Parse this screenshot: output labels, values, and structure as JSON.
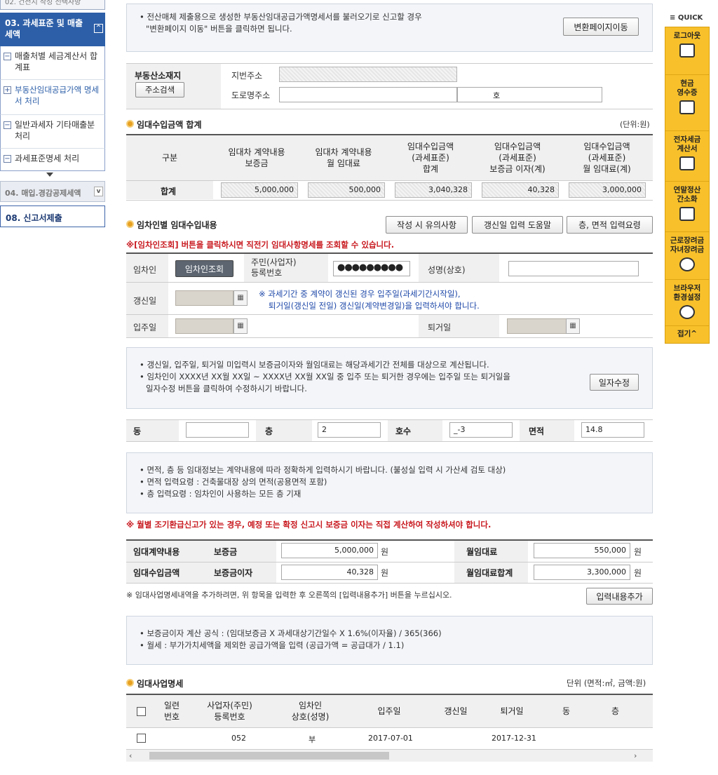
{
  "nav": {
    "top_text": "02. 건전지 작성 선택사항",
    "sec03": "03. 과세표준 및 매출세액",
    "items": [
      "매출처별 세금계산서 합계표",
      "부동산임대공급가액 명세서 처리",
      "일반과세자 기타매출분 처리",
      "과세표준명세 처리"
    ],
    "sec04": "04. 매입.경감공제세액",
    "sec08": "08. 신고서제출"
  },
  "notice1": {
    "text1": "전산매체 제출용으로 생성한 부동산임대공급가액명세서를 불러오기로 신고할 경우",
    "text2": "\"변환페이지 이동\" 버튼을 클릭하면 됩니다.",
    "button": "변환페이지이동"
  },
  "address": {
    "label": "부동산소재지",
    "search_button": "주소검색",
    "jibun_label": "지번주소",
    "road_label": "도로명주소",
    "road_extra": "호"
  },
  "summary": {
    "title": "임대수입금액 합계",
    "unit": "(단위:원)",
    "headers": [
      "구분",
      "임대차 계약내용\n보증금",
      "임대차 계약내용\n월 임대료",
      "임대수입금액\n(과세표준)\n합계",
      "임대수입금액\n(과세표준)\n보증금 이자(계)",
      "임대수입금액\n(과세표준)\n월 임대료(계)"
    ],
    "row_label": "합계",
    "values": [
      "5,000,000",
      "500,000",
      "3,040,328",
      "40,328",
      "3,000,000"
    ]
  },
  "tenant": {
    "title": "임차인별 임대수입내용",
    "buttons": [
      "작성 시 유의사항",
      "갱신일 입력 도움말",
      "층, 면적 입력요령"
    ],
    "red_note": "※[임차인조회] 버튼을 클릭하시면 직전기 임대사항명세를 조회할 수 있습니다.",
    "tenant_label": "임차인",
    "lookup_button": "임차인조회",
    "resid_label": "주민(사업자)\n등록번호",
    "resid_value": "●●●●●●●●●",
    "name_label": "성명(상호)",
    "renew_label": "갱신일",
    "renew_note1": "※ 과세기간 중 계약이 갱신된 경우 입주일(과세기간시작일),",
    "renew_note2": "퇴거일(갱신일 전일) 갱신일(계약변경일)을 입력하셔야 합니다.",
    "movein_label": "입주일",
    "moveout_label": "퇴거일"
  },
  "notice2": {
    "line1": "갱신일, 입주일, 퇴거일 미입력시 보증금이자와 월임대료는 해당과세기간 전체를 대상으로 계산됩니다.",
    "line2": "임차인이 XXXX년 XX월 XX일 ~ XXXX년 XX월 XX일 중 입주 또는 퇴거한 경우에는 입주일 또는 퇴거일을",
    "line3": "일자수정 버튼을 클릭하여 수정하시기 바랍니다.",
    "button": "일자수정"
  },
  "unit_row": {
    "dong_label": "동",
    "floor_label": "층",
    "floor_value": "2",
    "ho_label": "호수",
    "ho_value": "_-3",
    "area_label": "면적",
    "area_value": "14.8"
  },
  "notice3": {
    "line1": "면적, 층 등 임대정보는 계약내용에 따라 정확하게 입력하시기 바랍니다. (불성실 입력 시 가산세 검토 대상)",
    "line2": "면적 입력요령 : 건축물대장 상의 면적(공용면적 포함)",
    "line3": "층 입력요령 : 임차인이 사용하는 모든 층 기재"
  },
  "red_note2": "※ 월별 조기환급신고가 있는 경우, 예정 또는 확정 신고시 보증금 이자는 직접 계산하여 작성하셔야 합니다.",
  "contract": {
    "contract_label": "임대계약내용",
    "deposit_label": "보증금",
    "deposit_value": "5,000,000",
    "won": "원",
    "monthly_label": "월임대료",
    "monthly_value": "550,000",
    "income_label": "임대수입금액",
    "interest_label": "보증금이자",
    "interest_value": "40,328",
    "total_label": "월임대료합계",
    "total_value": "3,300,000"
  },
  "add_note": "※ 임대사업명세내역을 추가하려면, 위 항목을 입력한 후 오른쪽의 [입력내용추가] 버튼을 누르십시오.",
  "add_button": "입력내용추가",
  "notice4": {
    "line1": "보증금이자 계산 공식 : (임대보증금 X 과세대상기간일수 X 1.6%(이자율) / 365(366)",
    "line2": "월세 : 부가가치세액을 제외한 공급가액을 입력 (공급가액 = 공급대가 / 1.1)"
  },
  "biz": {
    "title": "임대사업명세",
    "unit": "단위 (면적:㎡, 금액:원)",
    "headers": [
      "일련\n번호",
      "사업자(주민)\n등록번호",
      "임차인\n상호(성명)",
      "입주일",
      "갱신일",
      "퇴거일",
      "동",
      "층"
    ],
    "row": {
      "resid": "052",
      "name": "부",
      "movein": "2017-07-01",
      "moveout": "2017-12-31"
    }
  },
  "quick": {
    "title": "≡ QUICK",
    "items": [
      "로그아웃",
      "현금\n영수증",
      "전자세금\n계산서",
      "연말정산\n간소화",
      "근로장려금\n자녀장려금",
      "브라우저\n환경설정"
    ],
    "close": "접기^"
  },
  "colors": {
    "nav_blue": "#2d5fa8",
    "accent_orange": "#e8a020",
    "quick_yellow": "#f8c12b",
    "red": "#c8191f"
  }
}
